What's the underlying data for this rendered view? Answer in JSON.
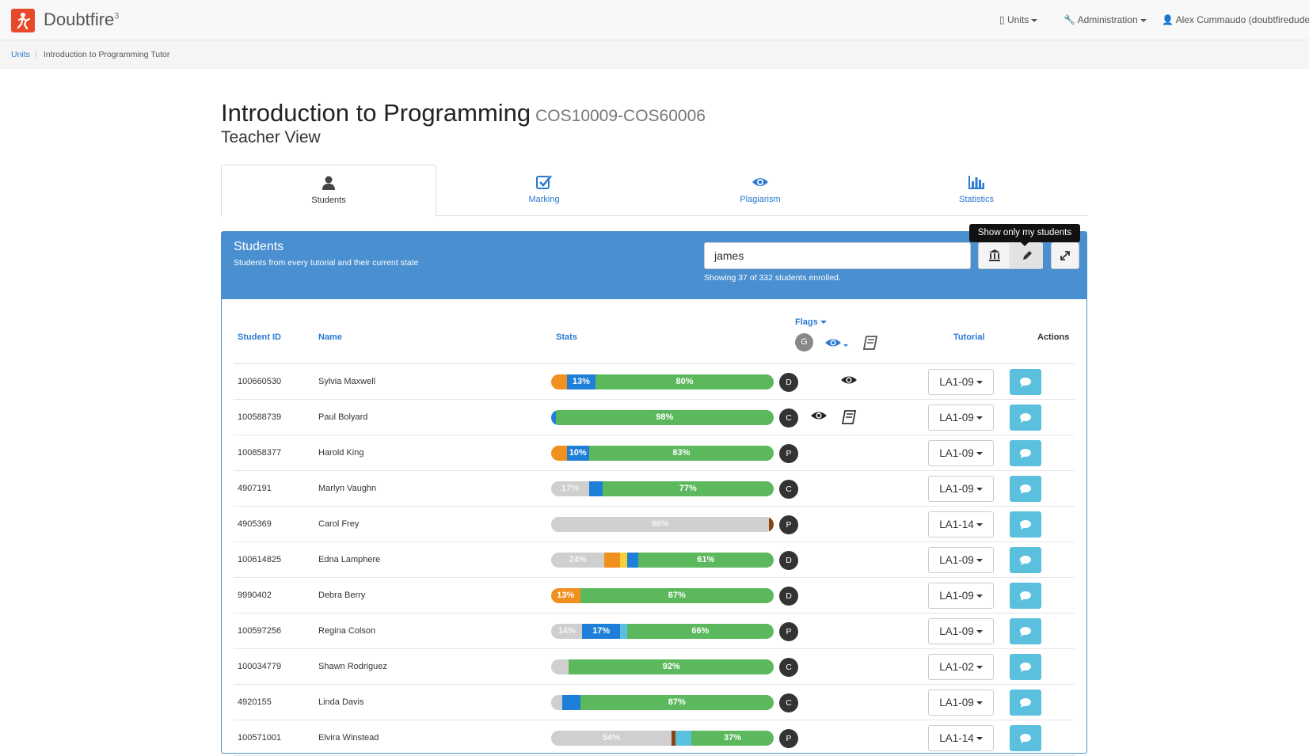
{
  "navbar": {
    "brand": "Doubtfire",
    "brand_sup": "3",
    "units": "Units",
    "administration": "Administration",
    "user": "Alex Cummaudo (doubtfiredude)"
  },
  "breadcrumb": {
    "units": "Units",
    "separator": "/",
    "current": "Introduction to Programming Tutor"
  },
  "page": {
    "title": "Introduction to Programming",
    "code": "COS10009-COS60006",
    "subtitle": "Teacher View"
  },
  "tabs": [
    {
      "label": "Students",
      "icon": "user-icon",
      "active": true
    },
    {
      "label": "Marking",
      "icon": "check-square-icon",
      "active": false
    },
    {
      "label": "Plagiarism",
      "icon": "eye-icon",
      "active": false
    },
    {
      "label": "Statistics",
      "icon": "bar-chart-icon",
      "active": false
    }
  ],
  "panel": {
    "title": "Students",
    "subtitle": "Students from every tutorial and their current state",
    "search_value": "james",
    "showing": "Showing 37 of 332 students enrolled.",
    "tooltip": "Show only my students"
  },
  "table": {
    "headers": {
      "student_id": "Student ID",
      "name": "Name",
      "stats": "Stats",
      "flags": "Flags",
      "flag_grade": "G",
      "tutorial": "Tutorial",
      "actions": "Actions"
    },
    "rows": [
      {
        "id": "100660530",
        "name": "Sylvia Maxwell",
        "grade": "D",
        "plagiarism": false,
        "eye2": true,
        "book": false,
        "tutorial": "LA1-09",
        "stats": [
          {
            "c": "#f0901f",
            "w": 7,
            "t": ""
          },
          {
            "c": "#1e7fd8",
            "w": 13,
            "t": "13%"
          },
          {
            "c": "#5cb85c",
            "w": 80,
            "t": "80%"
          }
        ]
      },
      {
        "id": "100588739",
        "name": "Paul Bolyard",
        "grade": "C",
        "plagiarism": true,
        "eye2": false,
        "book": true,
        "tutorial": "LA1-09",
        "stats": [
          {
            "c": "#1e7fd8",
            "w": 2,
            "t": ""
          },
          {
            "c": "#5cb85c",
            "w": 98,
            "t": "98%"
          }
        ]
      },
      {
        "id": "100858377",
        "name": "Harold King",
        "grade": "P",
        "plagiarism": false,
        "eye2": false,
        "book": false,
        "tutorial": "LA1-09",
        "stats": [
          {
            "c": "#f0901f",
            "w": 7,
            "t": ""
          },
          {
            "c": "#1e7fd8",
            "w": 10,
            "t": "10%"
          },
          {
            "c": "#5cb85c",
            "w": 83,
            "t": "83%"
          }
        ]
      },
      {
        "id": "4907191",
        "name": "Marlyn Vaughn",
        "grade": "C",
        "plagiarism": false,
        "eye2": false,
        "book": false,
        "tutorial": "LA1-09",
        "stats": [
          {
            "c": "#cfcfcf",
            "w": 17,
            "t": "17%"
          },
          {
            "c": "#1e7fd8",
            "w": 6,
            "t": ""
          },
          {
            "c": "#5cb85c",
            "w": 77,
            "t": "77%"
          }
        ]
      },
      {
        "id": "4905369",
        "name": "Carol Frey",
        "grade": "P",
        "plagiarism": false,
        "eye2": false,
        "book": false,
        "tutorial": "LA1-14",
        "stats": [
          {
            "c": "#cfcfcf",
            "w": 98,
            "t": "98%"
          },
          {
            "c": "#8b4513",
            "w": 2,
            "t": ""
          }
        ]
      },
      {
        "id": "100614825",
        "name": "Edna Lamphere",
        "grade": "D",
        "plagiarism": false,
        "eye2": false,
        "book": false,
        "tutorial": "LA1-09",
        "stats": [
          {
            "c": "#cfcfcf",
            "w": 24,
            "t": "24%"
          },
          {
            "c": "#f0901f",
            "w": 7,
            "t": ""
          },
          {
            "c": "#f5d03c",
            "w": 3,
            "t": ""
          },
          {
            "c": "#1e7fd8",
            "w": 5,
            "t": ""
          },
          {
            "c": "#5cb85c",
            "w": 61,
            "t": "61%"
          }
        ]
      },
      {
        "id": "9990402",
        "name": "Debra Berry",
        "grade": "D",
        "plagiarism": false,
        "eye2": false,
        "book": false,
        "tutorial": "LA1-09",
        "stats": [
          {
            "c": "#f0901f",
            "w": 13,
            "t": "13%"
          },
          {
            "c": "#5cb85c",
            "w": 87,
            "t": "87%"
          }
        ]
      },
      {
        "id": "100597256",
        "name": "Regina Colson",
        "grade": "P",
        "plagiarism": false,
        "eye2": false,
        "book": false,
        "tutorial": "LA1-09",
        "stats": [
          {
            "c": "#cfcfcf",
            "w": 14,
            "t": "14%"
          },
          {
            "c": "#1e7fd8",
            "w": 17,
            "t": "17%"
          },
          {
            "c": "#5bc0de",
            "w": 3,
            "t": ""
          },
          {
            "c": "#5cb85c",
            "w": 66,
            "t": "66%"
          }
        ]
      },
      {
        "id": "100034779",
        "name": "Shawn Rodriguez",
        "grade": "C",
        "plagiarism": false,
        "eye2": false,
        "book": false,
        "tutorial": "LA1-02",
        "stats": [
          {
            "c": "#cfcfcf",
            "w": 8,
            "t": ""
          },
          {
            "c": "#5cb85c",
            "w": 92,
            "t": "92%"
          }
        ]
      },
      {
        "id": "4920155",
        "name": "Linda Davis",
        "grade": "C",
        "plagiarism": false,
        "eye2": false,
        "book": false,
        "tutorial": "LA1-09",
        "stats": [
          {
            "c": "#cfcfcf",
            "w": 5,
            "t": ""
          },
          {
            "c": "#1e7fd8",
            "w": 8,
            "t": ""
          },
          {
            "c": "#5cb85c",
            "w": 87,
            "t": "87%"
          }
        ]
      },
      {
        "id": "100571001",
        "name": "Elvira Winstead",
        "grade": "P",
        "plagiarism": false,
        "eye2": false,
        "book": false,
        "tutorial": "LA1-14",
        "stats": [
          {
            "c": "#cfcfcf",
            "w": 54,
            "t": "54%"
          },
          {
            "c": "#8b4513",
            "w": 2,
            "t": ""
          },
          {
            "c": "#5bc0de",
            "w": 7,
            "t": ""
          },
          {
            "c": "#5cb85c",
            "w": 37,
            "t": "37%"
          }
        ]
      }
    ]
  },
  "colors": {
    "brand": "#e8492a",
    "panel_header": "#4a8fd0",
    "link": "#2a7ad1",
    "complete": "#5cb85c",
    "working": "#1e7fd8",
    "fix": "#f0901f",
    "action_button": "#5bc0de"
  }
}
